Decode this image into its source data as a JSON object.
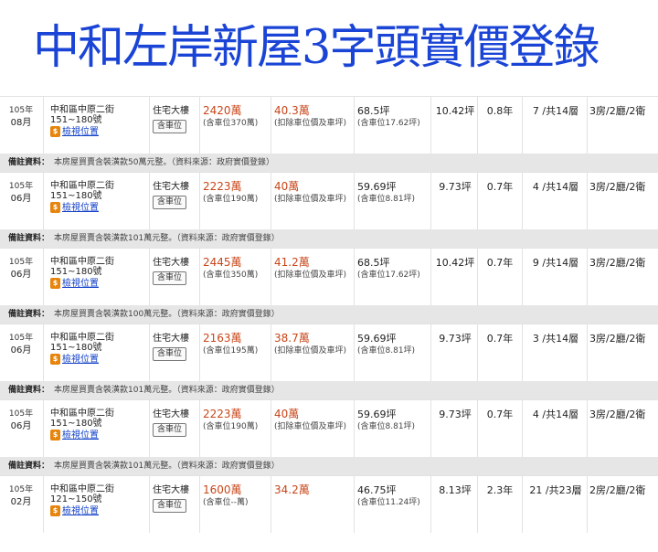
{
  "title": "中和左岸新屋3字頭實價登錄",
  "note_label": "備註資料：",
  "map_label": "檢視位置",
  "map_icon": "dollar-map-pin-icon",
  "colors": {
    "title": "#1a44d6",
    "price": "#c8461a",
    "link": "#1240c8",
    "pin": "#e6850e",
    "note_bg": "#e6e6e6"
  },
  "records": [
    {
      "year": "105年",
      "month": "08月",
      "street": "中和區中原二街",
      "number": "151~180號",
      "type": "住宅大樓",
      "parking_badge": "含車位",
      "total": "2420萬",
      "total_note": "(含車位370萬)",
      "unit_price": "40.3萬",
      "unit_note": "(扣除車位價及車坪)",
      "area": "68.5坪",
      "area_note": "(含車位17.62坪)",
      "ping": "10.42坪",
      "ratio": "0.8年",
      "floor": "7 /共14層",
      "layout": "3房/2廳/2衛",
      "note": "本房屋買賣含裝潢款50萬元整。（資料來源：政府實價登錄）"
    },
    {
      "year": "105年",
      "month": "06月",
      "street": "中和區中原二街",
      "number": "151~180號",
      "type": "住宅大樓",
      "parking_badge": "含車位",
      "total": "2223萬",
      "total_note": "(含車位190萬)",
      "unit_price": "40萬",
      "unit_note": "(扣除車位價及車坪)",
      "area": "59.69坪",
      "area_note": "(含車位8.81坪)",
      "ping": "9.73坪",
      "ratio": "0.7年",
      "floor": "4 /共14層",
      "layout": "3房/2廳/2衛",
      "note": "本房屋買賣含裝潢款101萬元整。（資料來源：政府實價登錄）"
    },
    {
      "year": "105年",
      "month": "06月",
      "street": "中和區中原二街",
      "number": "151~180號",
      "type": "住宅大樓",
      "parking_badge": "含車位",
      "total": "2445萬",
      "total_note": "(含車位350萬)",
      "unit_price": "41.2萬",
      "unit_note": "(扣除車位價及車坪)",
      "area": "68.5坪",
      "area_note": "(含車位17.62坪)",
      "ping": "10.42坪",
      "ratio": "0.7年",
      "floor": "9 /共14層",
      "layout": "3房/2廳/2衛",
      "note": "本房屋買賣含裝潢款100萬元整。（資料來源：政府實價登錄）"
    },
    {
      "year": "105年",
      "month": "06月",
      "street": "中和區中原二街",
      "number": "151~180號",
      "type": "住宅大樓",
      "parking_badge": "含車位",
      "total": "2163萬",
      "total_note": "(含車位195萬)",
      "unit_price": "38.7萬",
      "unit_note": "(扣除車位價及車坪)",
      "area": "59.69坪",
      "area_note": "(含車位8.81坪)",
      "ping": "9.73坪",
      "ratio": "0.7年",
      "floor": "3 /共14層",
      "layout": "3房/2廳/2衛",
      "note": "本房屋買賣含裝潢款101萬元整。（資料來源：政府實價登錄）"
    },
    {
      "year": "105年",
      "month": "06月",
      "street": "中和區中原二街",
      "number": "151~180號",
      "type": "住宅大樓",
      "parking_badge": "含車位",
      "total": "2223萬",
      "total_note": "(含車位190萬)",
      "unit_price": "40萬",
      "unit_note": "(扣除車位價及車坪)",
      "area": "59.69坪",
      "area_note": "(含車位8.81坪)",
      "ping": "9.73坪",
      "ratio": "0.7年",
      "floor": "4 /共14層",
      "layout": "3房/2廳/2衛",
      "note": "本房屋買賣含裝潢款101萬元整。（資料來源：政府實價登錄）"
    },
    {
      "year": "105年",
      "month": "02月",
      "street": "中和區中原二街",
      "number": "121~150號",
      "type": "住宅大樓",
      "parking_badge": "含車位",
      "total": "1600萬",
      "total_note": "(含車位--萬)",
      "unit_price": "34.2萬",
      "unit_note": "",
      "area": "46.75坪",
      "area_note": "(含車位11.24坪)",
      "ping": "8.13坪",
      "ratio": "2.3年",
      "floor": "21 /共23層",
      "layout": "2房/2廳/2衛",
      "note": ""
    }
  ]
}
